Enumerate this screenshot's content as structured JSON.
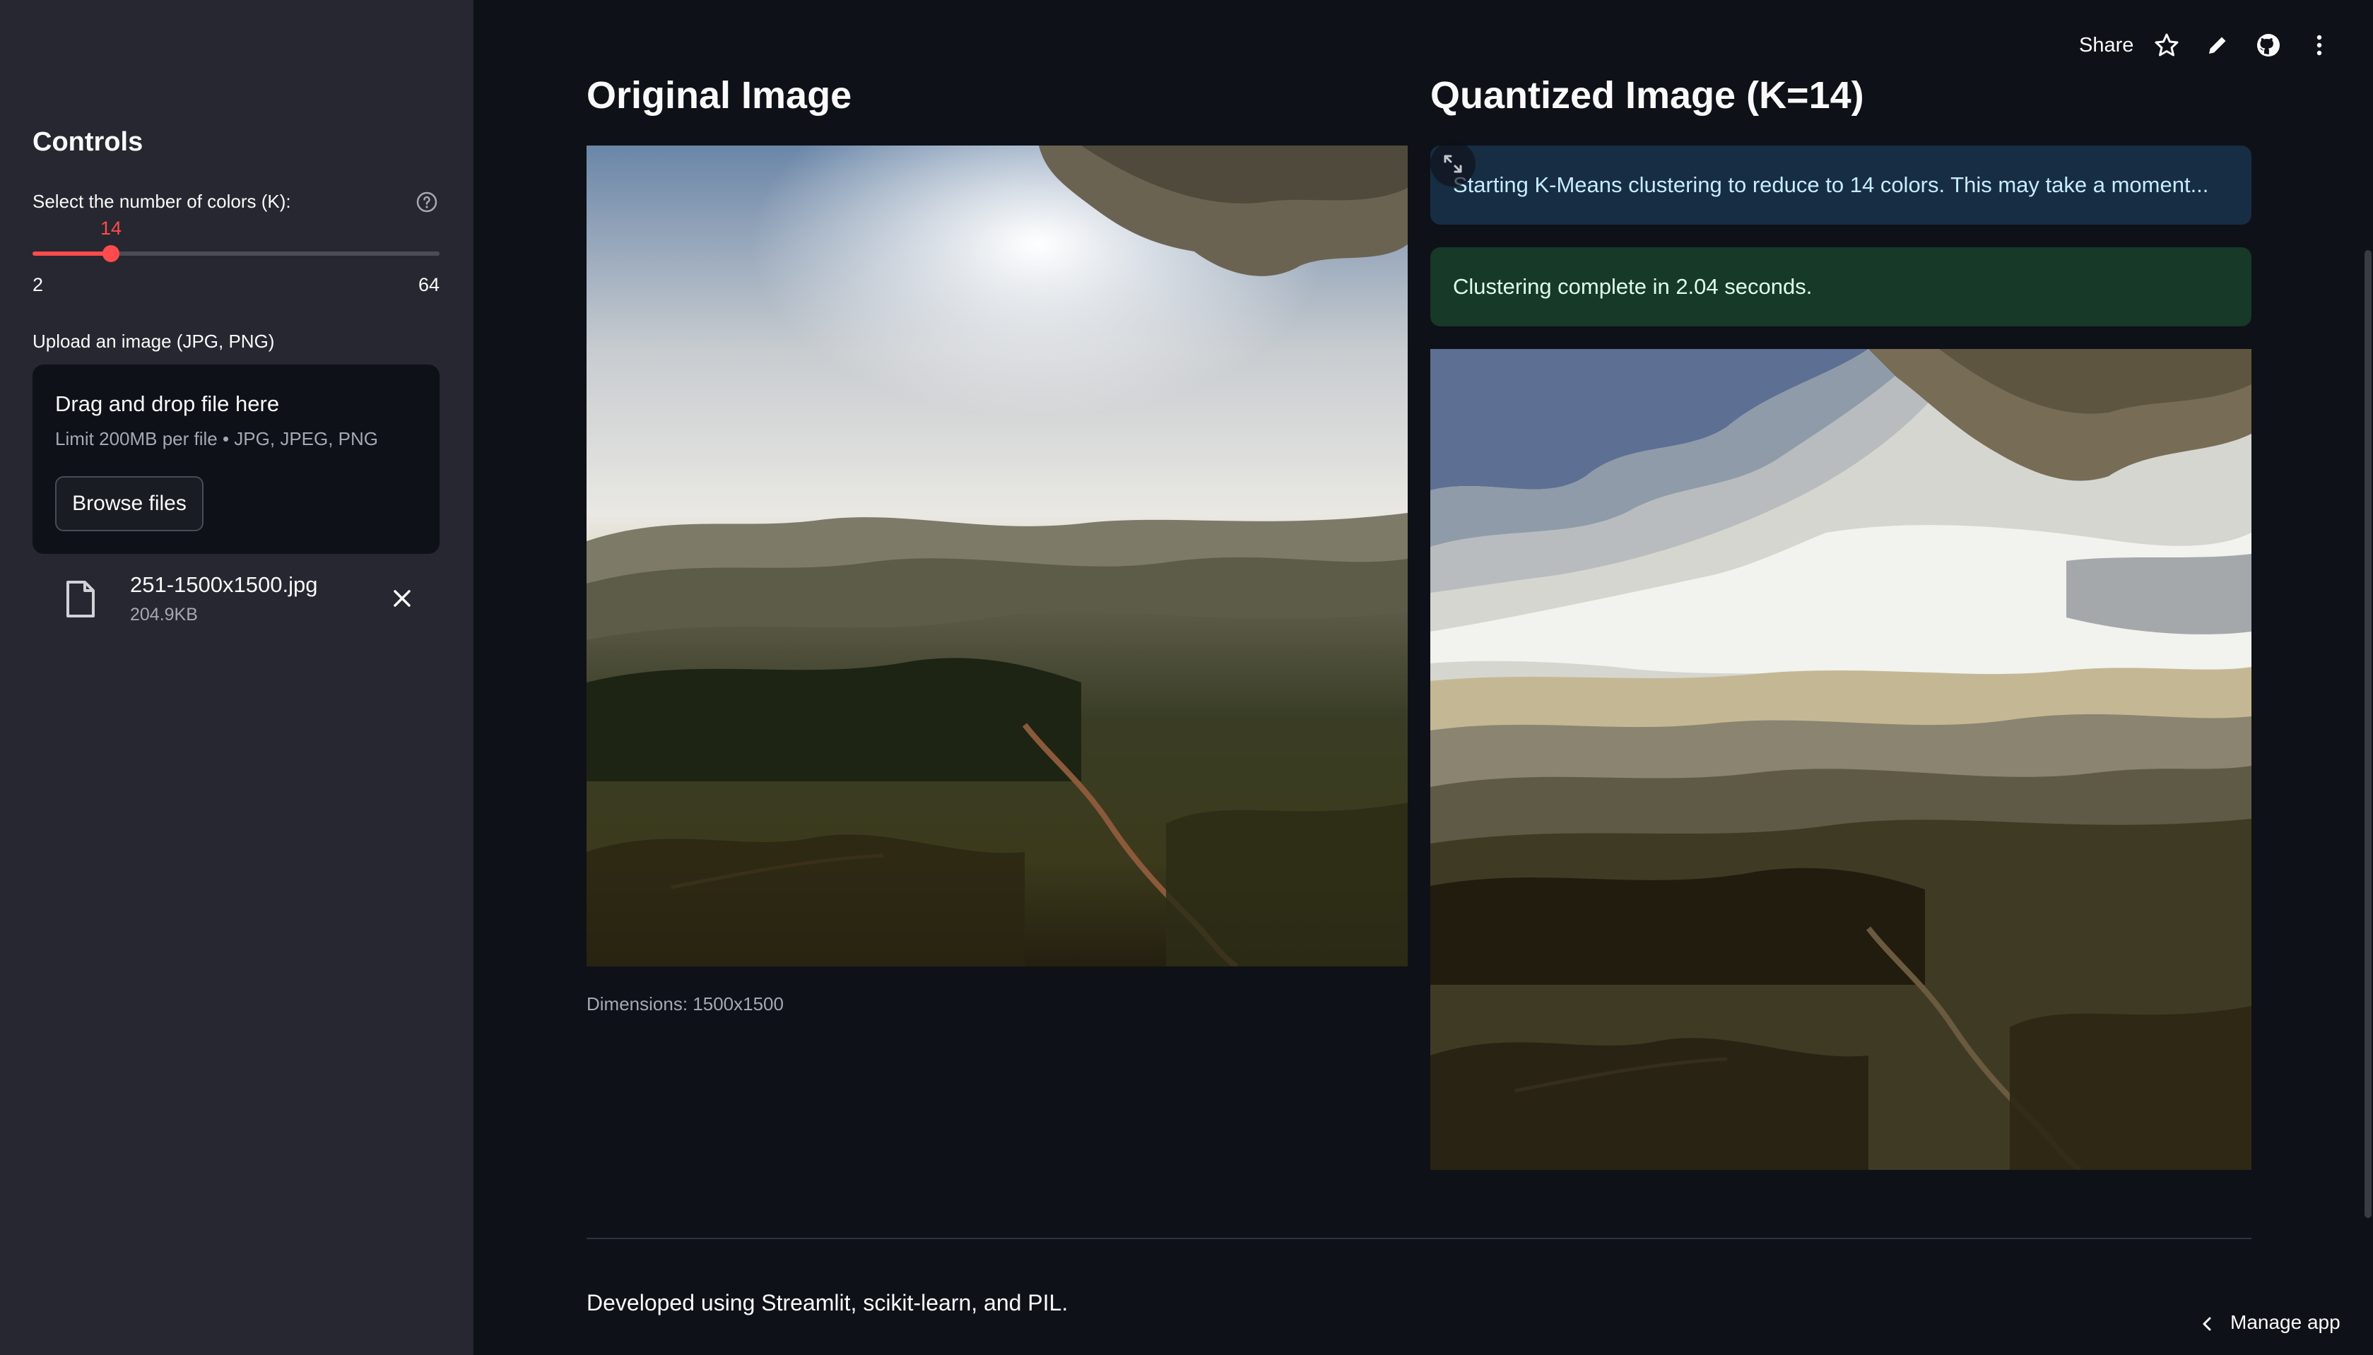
{
  "sidebar": {
    "title": "Controls",
    "slider_label": "Select the number of colors (K):",
    "slider": {
      "value": 14,
      "min": 2,
      "max": 64,
      "value_label": "14",
      "min_label": "2",
      "max_label": "64"
    },
    "upload_label": "Upload an image (JPG, PNG)",
    "dropzone": {
      "title": "Drag and drop file here",
      "limit": "Limit 200MB per file • JPG, JPEG, PNG",
      "browse_label": "Browse files"
    },
    "file": {
      "name": "251-1500x1500.jpg",
      "size": "204.9KB"
    }
  },
  "main": {
    "original_heading": "Original Image",
    "quantized_heading": "Quantized Image (K=14)",
    "caption": "Dimensions: 1500x1500",
    "info_message": "Starting K-Means clustering to reduce to 14 colors. This may take a moment...",
    "success_message": "Clustering complete in 2.04 seconds.",
    "footer": "Developed using Streamlit, scikit-learn, and PIL."
  },
  "toolbar": {
    "share_label": "Share",
    "manage_label": "Manage app"
  },
  "colors": {
    "background": "#0e1117",
    "sidebar": "#262730",
    "accent": "#ff4b4b",
    "info_bg": "#172d43",
    "success_bg": "#173928"
  }
}
